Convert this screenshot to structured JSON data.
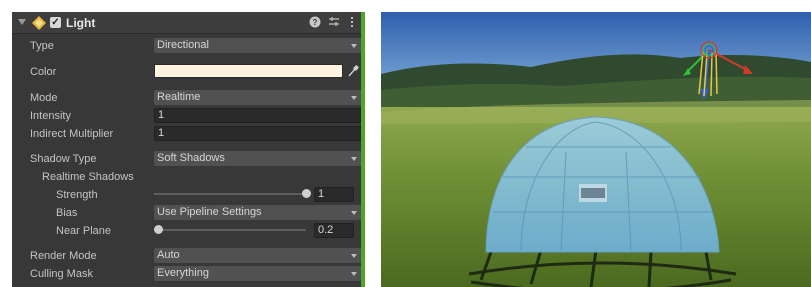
{
  "component": {
    "title": "Light",
    "help_icon": "help-icon",
    "presets_icon": "presets-icon",
    "menu_icon": "kebab-menu-icon"
  },
  "fields": {
    "type": {
      "label": "Type",
      "value": "Directional"
    },
    "color": {
      "label": "Color",
      "value": "#FFF4E0"
    },
    "mode": {
      "label": "Mode",
      "value": "Realtime"
    },
    "intensity": {
      "label": "Intensity",
      "value": "1"
    },
    "indirect_multiplier": {
      "label": "Indirect Multiplier",
      "value": "1"
    },
    "shadow_type": {
      "label": "Shadow Type",
      "value": "Soft Shadows"
    },
    "realtime_shadows": {
      "label": "Realtime Shadows"
    },
    "strength": {
      "label": "Strength",
      "value": "1",
      "fraction": 1.0
    },
    "bias": {
      "label": "Bias",
      "value": "Use Pipeline Settings"
    },
    "near_plane": {
      "label": "Near Plane",
      "value": "0.2",
      "fraction": 0.0
    },
    "render_mode": {
      "label": "Render Mode",
      "value": "Auto"
    },
    "culling_mask": {
      "label": "Culling Mask",
      "value": "Everything"
    }
  },
  "colors": {
    "inspector_bg": "#383838",
    "accent_green": "#4FA62F",
    "light_color": "#FFF4E0"
  }
}
